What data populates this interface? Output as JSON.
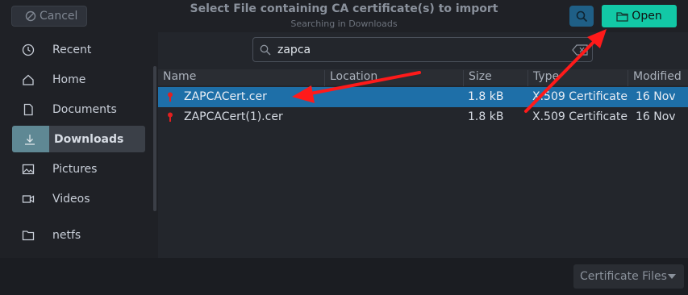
{
  "header": {
    "cancel_label": "Cancel",
    "title": "Select File containing CA certificate(s) to import",
    "subtitle": "Searching in Downloads",
    "open_label": "Open"
  },
  "sidebar": {
    "items": [
      {
        "label": "Recent",
        "icon": "clock-icon"
      },
      {
        "label": "Home",
        "icon": "home-icon"
      },
      {
        "label": "Documents",
        "icon": "document-icon"
      },
      {
        "label": "Downloads",
        "icon": "download-icon",
        "active": true
      },
      {
        "label": "Pictures",
        "icon": "image-icon"
      },
      {
        "label": "Videos",
        "icon": "video-icon"
      },
      {
        "label": "netfs",
        "icon": "folder-icon"
      }
    ]
  },
  "search": {
    "value": "zapca"
  },
  "table": {
    "columns": [
      "Name",
      "Location",
      "Size",
      "Type",
      "Modified"
    ],
    "rows": [
      {
        "name": "ZAPCACert.cer",
        "location": "",
        "size": "1.8 kB",
        "type": "X.509 Certificate",
        "modified": "16 Nov",
        "selected": true
      },
      {
        "name": "ZAPCACert(1).cer",
        "location": "",
        "size": "1.8 kB",
        "type": "X.509 Certificate",
        "modified": "16 Nov",
        "selected": false
      }
    ]
  },
  "footer": {
    "filter_label": "Certificate Files"
  },
  "colors": {
    "accent_open": "#12c8a6",
    "selection": "#1e6fa8",
    "annotation_arrow": "#ff1a1a",
    "file_icon": "#e02020"
  }
}
